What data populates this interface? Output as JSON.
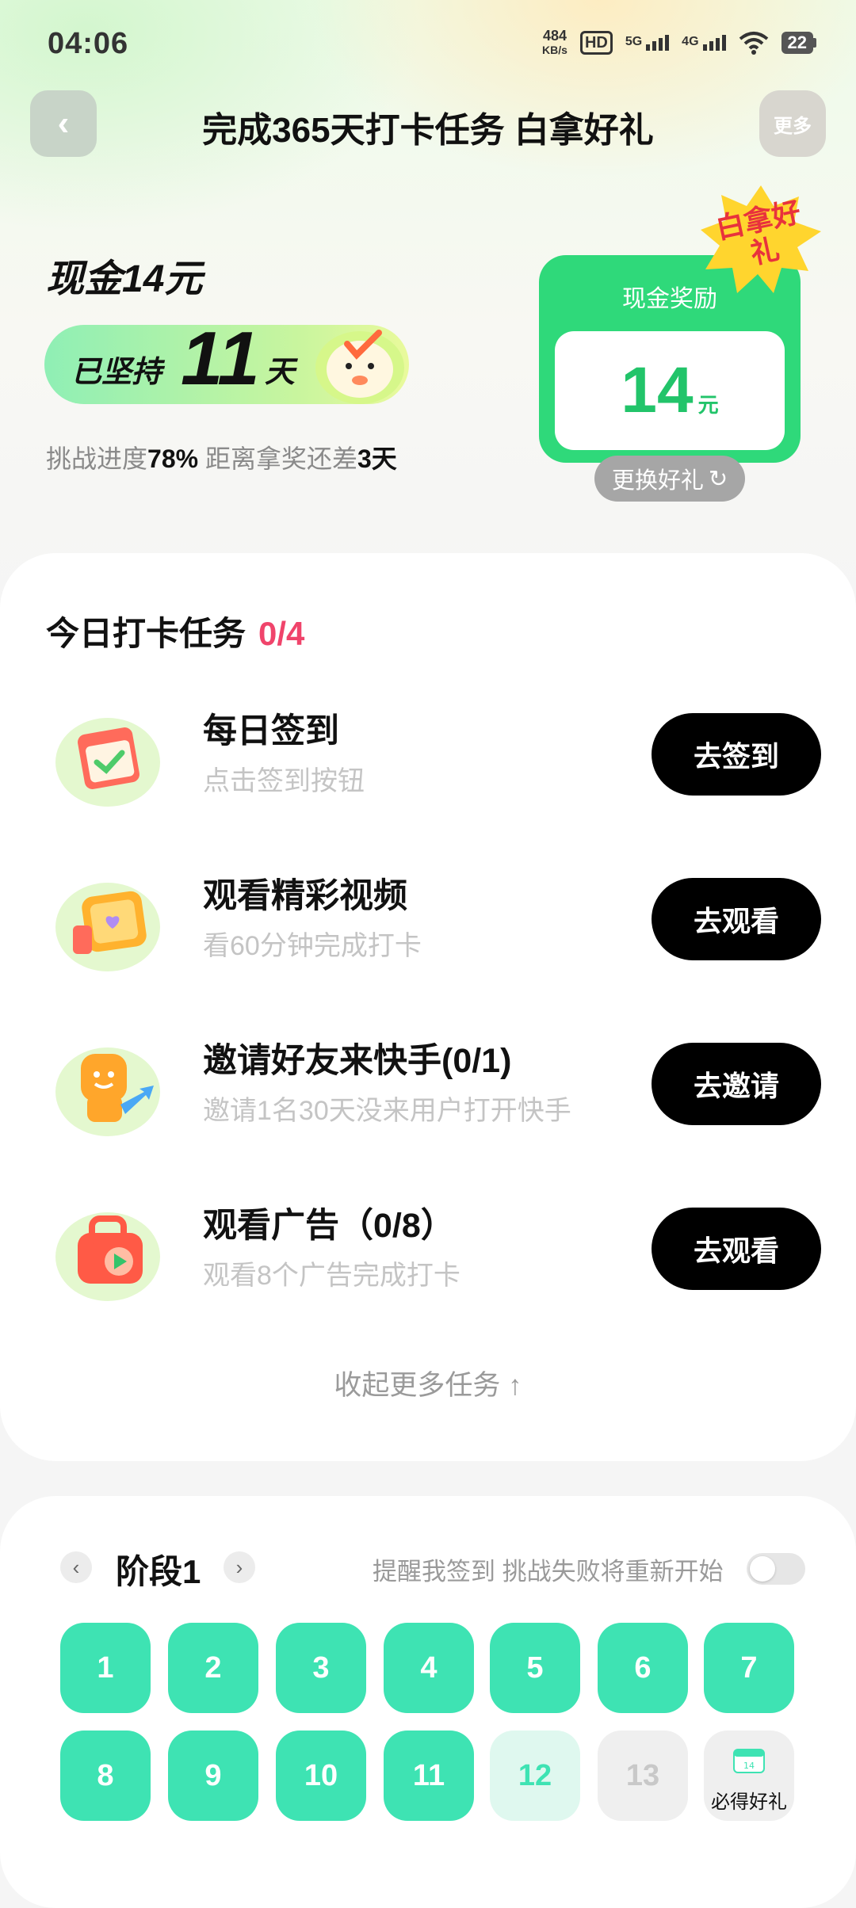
{
  "status_bar": {
    "time": "04:06",
    "net_speed_value": "484",
    "net_speed_unit": "KB/s",
    "hd_label": "HD",
    "signal1_label": "5G",
    "signal2_label": "4G",
    "battery": "22"
  },
  "header": {
    "back_icon": "‹",
    "title": "完成365天打卡任务 白拿好礼",
    "more_label": "更多"
  },
  "hero": {
    "cash_title": "现金14元",
    "persist_prefix": "已坚持",
    "persist_days": "11",
    "persist_suffix": "天",
    "progress_prefix": "挑战进度",
    "progress_percent": "78%",
    "progress_middle": " 距离拿奖还差",
    "days_left": "3天",
    "progress_fraction": 0.78
  },
  "reward": {
    "label": "现金奖励",
    "amount": "14",
    "unit": "元",
    "badge": "白拿好礼",
    "swap_label": "更换好礼",
    "swap_icon": "↻",
    "card_color": "#2fd97a"
  },
  "tasks": {
    "heading": "今日打卡任务",
    "count": "0/4",
    "items": [
      {
        "title": "每日签到",
        "subtitle": "点击签到按钮",
        "button": "去签到",
        "icon": "calendar-check-icon"
      },
      {
        "title": "观看精彩视频",
        "subtitle": "看60分钟完成打卡",
        "button": "去观看",
        "icon": "video-heart-icon"
      },
      {
        "title": "邀请好友来快手(0/1)",
        "subtitle": "邀请1名30天没来用户打开快手",
        "button": "去邀请",
        "icon": "invite-friend-icon"
      },
      {
        "title": "观看广告（0/8）",
        "subtitle": "观看8个广告完成打卡",
        "button": "去观看",
        "icon": "ad-play-icon"
      }
    ],
    "collapse_label": "收起更多任务 ↑"
  },
  "stage": {
    "prev_icon": "‹",
    "label": "阶段1",
    "next_icon": "›",
    "remind_text": "提醒我签到 挑战失败将重新开始",
    "remind_enabled": false,
    "days": [
      {
        "n": "1",
        "state": "done"
      },
      {
        "n": "2",
        "state": "done"
      },
      {
        "n": "3",
        "state": "done"
      },
      {
        "n": "4",
        "state": "done"
      },
      {
        "n": "5",
        "state": "done"
      },
      {
        "n": "6",
        "state": "done"
      },
      {
        "n": "7",
        "state": "done"
      },
      {
        "n": "8",
        "state": "done"
      },
      {
        "n": "9",
        "state": "done"
      },
      {
        "n": "10",
        "state": "done"
      },
      {
        "n": "11",
        "state": "done"
      },
      {
        "n": "12",
        "state": "today"
      },
      {
        "n": "13",
        "state": "future"
      }
    ],
    "gift_cal_number": "14",
    "gift_label": "必得好礼",
    "done_color": "#3ee3b3"
  }
}
